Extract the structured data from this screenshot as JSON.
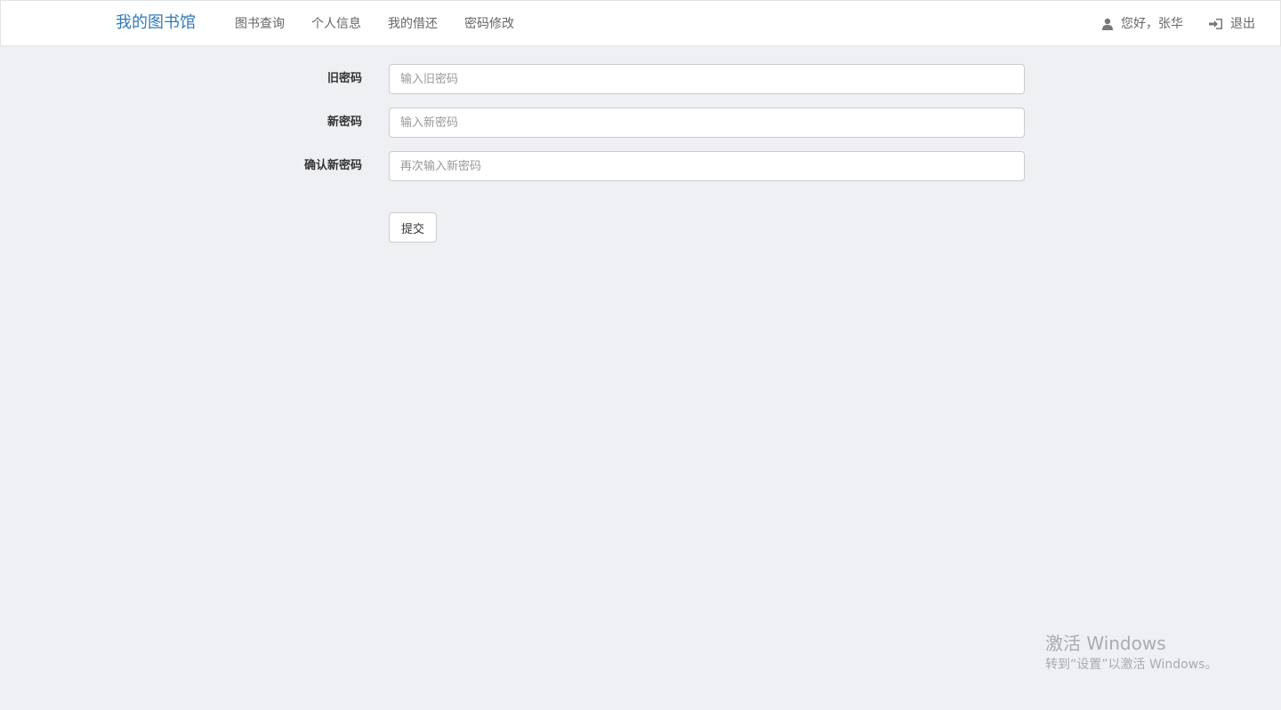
{
  "navbar": {
    "brand": "我的图书馆",
    "links": [
      "图书查询",
      "个人信息",
      "我的借还",
      "密码修改"
    ],
    "greeting": "您好，张华",
    "logout": "退出"
  },
  "form": {
    "old_password": {
      "label": "旧密码",
      "placeholder": "输入旧密码"
    },
    "new_password": {
      "label": "新密码",
      "placeholder": "输入新密码"
    },
    "confirm_password": {
      "label": "确认新密码",
      "placeholder": "再次输入新密码"
    },
    "submit_label": "提交"
  },
  "watermark": {
    "title": "激活 Windows",
    "subtitle": "转到“设置”以激活 Windows。"
  },
  "icons": {
    "user": "user-icon",
    "logout": "log-in-icon"
  }
}
